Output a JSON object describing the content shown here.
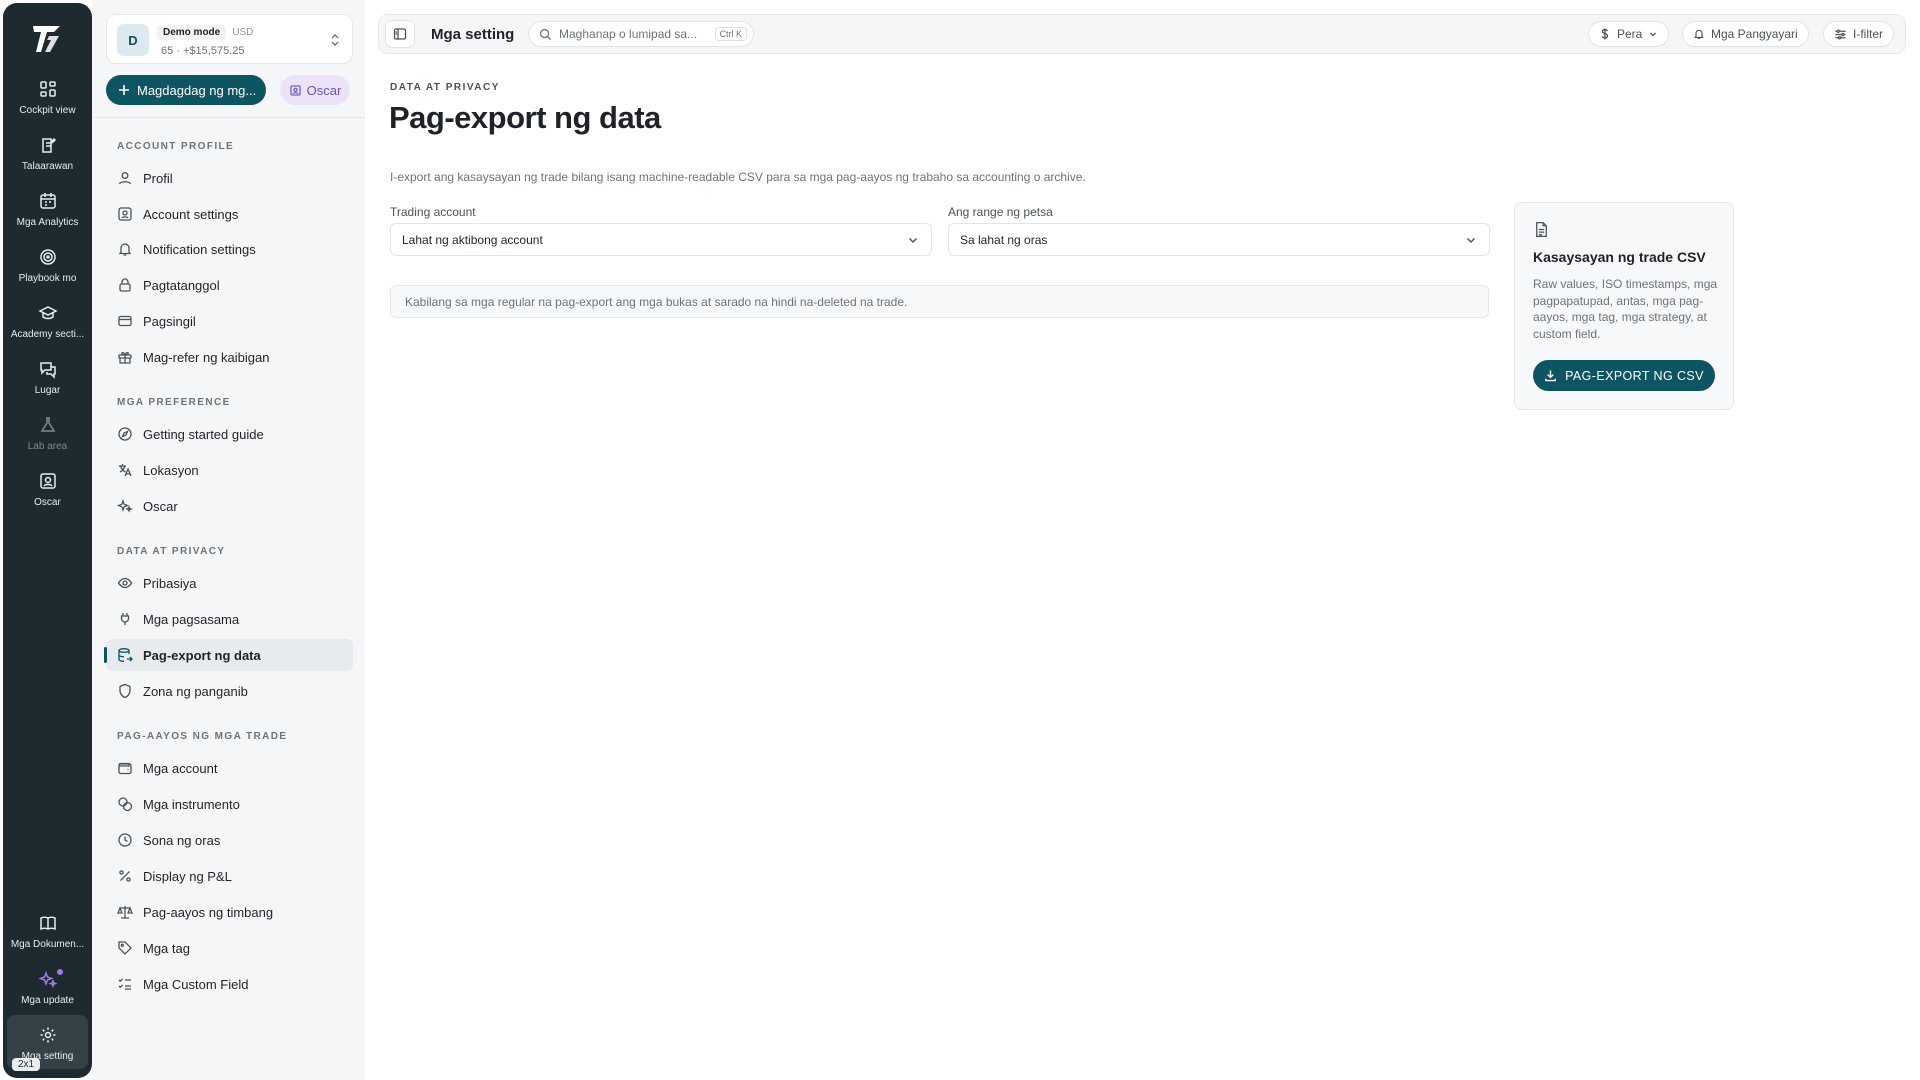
{
  "rail": {
    "items": [
      {
        "label": "Cockpit view",
        "icon": "grid-icon"
      },
      {
        "label": "Talaarawan",
        "icon": "journal-icon"
      },
      {
        "label": "Mga Analytics",
        "icon": "calendar-icon"
      },
      {
        "label": "Playbook mo",
        "icon": "target-icon"
      },
      {
        "label": "Academy secti...",
        "icon": "graduation-cap-icon"
      },
      {
        "label": "Lugar",
        "icon": "chat-icon"
      },
      {
        "label": "Lab area",
        "icon": "flask-icon"
      },
      {
        "label": "Oscar",
        "icon": "contact-icon"
      }
    ],
    "bottom": [
      {
        "label": "Mga Dokumen...",
        "icon": "book-icon"
      },
      {
        "label": "Mga update",
        "icon": "sparkles-icon"
      },
      {
        "label": "Mga setting",
        "icon": "gear-icon"
      }
    ],
    "badge": "2x1"
  },
  "account": {
    "avatar": "D",
    "mode": "Demo mode",
    "currency": "USD",
    "balance": "65 · +$15,575.25"
  },
  "sidebar": {
    "add_button": "Magdagdag ng mg...",
    "oscar_chip": "Oscar",
    "sections": [
      {
        "title": "ACCOUNT PROFILE",
        "items": [
          {
            "label": "Profil",
            "icon": "user-icon"
          },
          {
            "label": "Account settings",
            "icon": "user-square-icon"
          },
          {
            "label": "Notification settings",
            "icon": "bell-icon"
          },
          {
            "label": "Pagtatanggol",
            "icon": "lock-icon"
          },
          {
            "label": "Pagsingil",
            "icon": "credit-card-icon"
          },
          {
            "label": "Mag-refer ng kaibigan",
            "icon": "gift-icon"
          }
        ]
      },
      {
        "title": "MGA PREFERENCE",
        "items": [
          {
            "label": "Getting started guide",
            "icon": "compass-icon"
          },
          {
            "label": "Lokasyon",
            "icon": "translate-icon"
          },
          {
            "label": "Oscar",
            "icon": "sparkle-icon"
          }
        ]
      },
      {
        "title": "DATA AT PRIVACY",
        "items": [
          {
            "label": "Pribasiya",
            "icon": "eye-icon"
          },
          {
            "label": "Mga pagsasama",
            "icon": "plug-icon"
          },
          {
            "label": "Pag-export ng data",
            "icon": "database-export-icon"
          },
          {
            "label": "Zona ng panganib",
            "icon": "shield-icon"
          }
        ]
      },
      {
        "title": "PAG-AAYOS NG MGA TRADE",
        "items": [
          {
            "label": "Mga account",
            "icon": "wallet-icon"
          },
          {
            "label": "Mga instrumento",
            "icon": "coins-icon"
          },
          {
            "label": "Sona ng oras",
            "icon": "clock-icon"
          },
          {
            "label": "Display ng P&L",
            "icon": "percent-icon"
          },
          {
            "label": "Pag-aayos ng timbang",
            "icon": "scale-icon"
          },
          {
            "label": "Mga tag",
            "icon": "tag-icon"
          },
          {
            "label": "Mga Custom Field",
            "icon": "list-checks-icon"
          }
        ]
      }
    ]
  },
  "topbar": {
    "title": "Mga setting",
    "search_placeholder": "Maghanap o lumipad sa...",
    "search_shortcut": "Ctrl K",
    "currency_button": "Pera",
    "events_button": "Mga Pangyayari",
    "filter_button": "I-filter"
  },
  "main": {
    "eyebrow": "DATA AT PRIVACY",
    "title": "Pag-export ng data",
    "description": "I-export ang kasaysayan ng trade bilang isang machine-readable CSV para sa mga pag-aayos ng trabaho sa accounting o archive.",
    "account_label": "Trading account",
    "account_value": "Lahat ng aktibong account",
    "range_label": "Ang range ng petsa",
    "range_value": "Sa lahat ng oras",
    "note": "Kabilang sa mga regular na pag-export ang mga bukas at sarado na hindi na-deleted na trade.",
    "card": {
      "title": "Kasaysayan ng trade CSV",
      "description": "Raw values, ISO timestamps, mga pagpapatupad, antas, mga pag-aayos, mga tag, mga strategy, at custom field.",
      "button": "PAG-EXPORT NG CSV"
    }
  },
  "colors": {
    "accent": "#0e5563",
    "rail_bg": "#1e2a30",
    "sidebar_bg": "#f5f6f7",
    "oscar": "#6b4fbf"
  }
}
